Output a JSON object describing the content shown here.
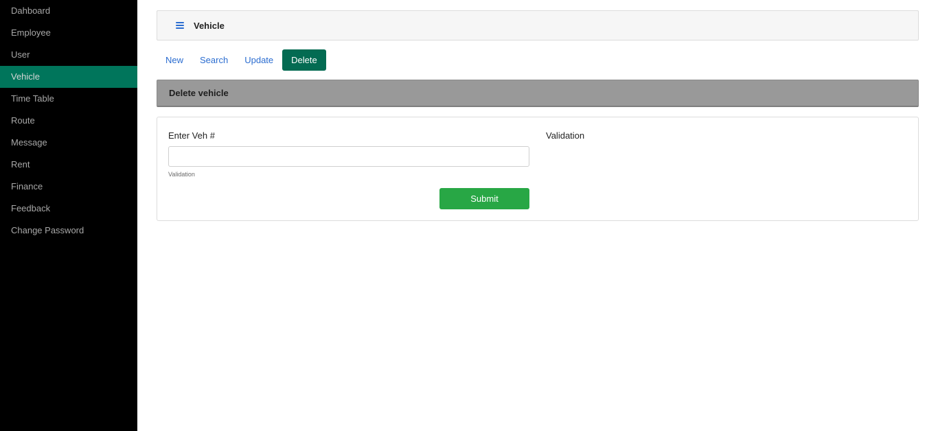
{
  "sidebar": {
    "items": [
      {
        "label": "Dahboard"
      },
      {
        "label": "Employee"
      },
      {
        "label": "User"
      },
      {
        "label": "Vehicle"
      },
      {
        "label": "Time Table"
      },
      {
        "label": "Route"
      },
      {
        "label": "Message"
      },
      {
        "label": "Rent"
      },
      {
        "label": "Finance"
      },
      {
        "label": "Feedback"
      },
      {
        "label": "Change Password"
      }
    ],
    "active": "Vehicle"
  },
  "header": {
    "icon": "hamburger-menu-icon",
    "title": "Vehicle"
  },
  "nav": {
    "tabs": [
      {
        "label": "New"
      },
      {
        "label": "Search"
      },
      {
        "label": "Update"
      },
      {
        "label": "Delete"
      }
    ],
    "active": "Delete"
  },
  "section": {
    "title": "Delete vehicle"
  },
  "form": {
    "field_label": "Enter Veh #",
    "field_value": "",
    "field_help": "Validation",
    "submit_label": "Submit",
    "side_label": "Validation"
  },
  "colors": {
    "sidebar_bg": "#000000",
    "sidebar_active": "#00755b",
    "nav_active": "#036b52",
    "link": "#2a6cd0",
    "submit": "#28a745",
    "section_bar": "#999999"
  }
}
